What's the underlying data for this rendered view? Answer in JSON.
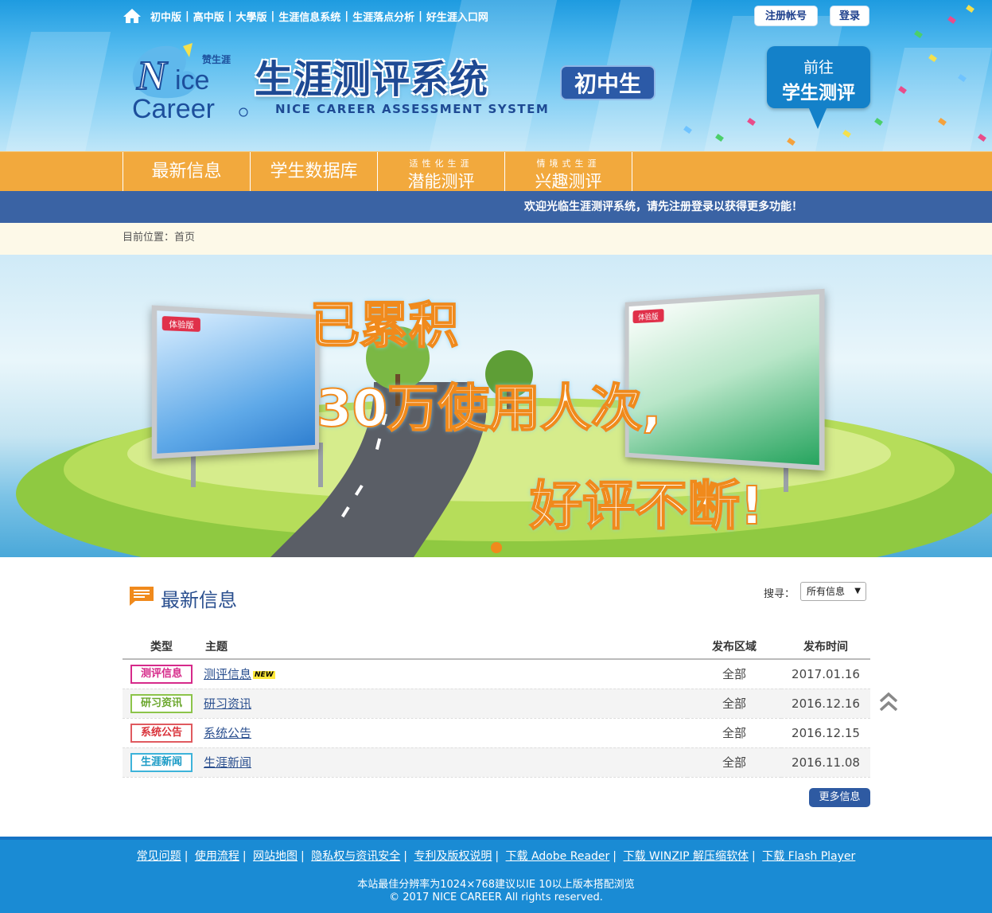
{
  "topnav": {
    "links": [
      "初中版",
      "高中版",
      "大學版",
      "生涯信息系统",
      "生涯落点分析",
      "好生涯入口网"
    ],
    "register": "注册帐号",
    "login": "登录"
  },
  "brand": {
    "logo_small": "赞生涯",
    "title": "生涯测评系统",
    "subtitle": "NICE CAREER ASSESSMENT SYSTEM",
    "grade": "初中生",
    "goto_line1": "前往",
    "goto_line2": "学生测评"
  },
  "mainnav": [
    {
      "label": "最新信息"
    },
    {
      "label": "学生数据库"
    },
    {
      "small": "适性化生涯",
      "label": "潜能测评"
    },
    {
      "small": "情境式生涯",
      "label": "兴趣测评"
    }
  ],
  "welcome": "欢迎光临生涯测评系统，请先注册登录以获得更多功能！",
  "breadcrumb": "目前位置：首页",
  "banner": {
    "line1": "已累积",
    "line2": "30万使用人次,",
    "line3": "好评不断!",
    "board_left_tag": "体验版",
    "board_right_tag": "体验版"
  },
  "news": {
    "title": "最新信息",
    "search_label": "搜寻：",
    "filter_value": "所有信息",
    "columns": [
      "类型",
      "主题",
      "发布区域",
      "发布时间"
    ],
    "rows": [
      {
        "type": "测评信息",
        "subject": "测评信息",
        "badge": "NEW",
        "area": "全部",
        "date": "2017.01.16"
      },
      {
        "type": "研习资讯",
        "subject": "研习资讯",
        "badge": "",
        "area": "全部",
        "date": "2016.12.16"
      },
      {
        "type": "系统公告",
        "subject": "系统公告",
        "badge": "",
        "area": "全部",
        "date": "2016.12.15"
      },
      {
        "type": "生涯新闻",
        "subject": "生涯新闻",
        "badge": "",
        "area": "全部",
        "date": "2016.11.08"
      }
    ],
    "more": "更多信息"
  },
  "footer": {
    "links": [
      "常见问题",
      "使用流程",
      "网站地图",
      "隐私权与资讯安全",
      "专利及版权说明",
      "下载 Adobe Reader",
      "下载 WINZIP 解压缩软体",
      "下载 Flash Player"
    ],
    "note1": "本站最佳分辨率为1024×768建议以IE 10以上版本搭配浏览",
    "note2": "© 2017 NICE CAREER All rights reserved."
  },
  "colors": {
    "nav_orange": "#f2a93d",
    "welcome_blue": "#3a63a4",
    "footer_blue": "#1a8bd4"
  }
}
